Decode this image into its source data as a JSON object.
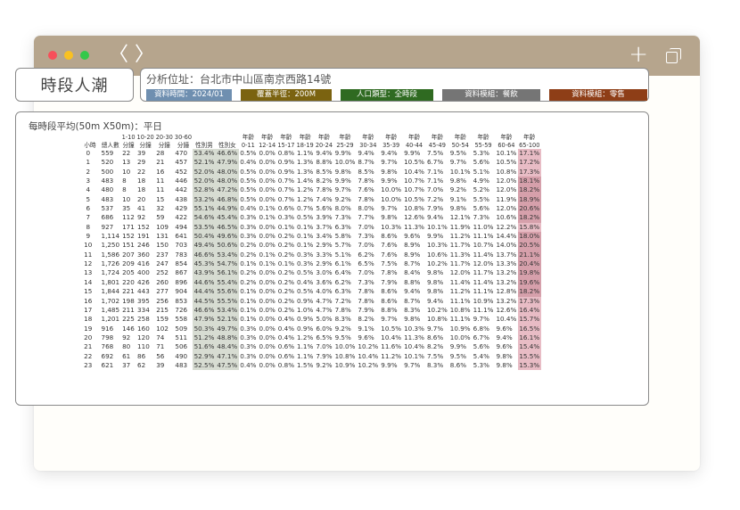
{
  "browser": {
    "back_label": "〈",
    "forward_label": "〉",
    "new_tab_label": "+",
    "colors": {
      "titlebar": "#b6a58d",
      "close": "#f74f5a",
      "minimize": "#f9c122",
      "maximize": "#34c84a"
    }
  },
  "header": {
    "title": "時段人潮",
    "location": "分析位址：台北市中山區南京西路14號",
    "tags": [
      {
        "label": "資料時間：2024/01",
        "color": "#6f8fb0",
        "width": 96
      },
      {
        "label": "覆蓋半徑：200M",
        "color": "#7b6310",
        "width": 102
      },
      {
        "label": "人口類型：全時段",
        "color": "#2f6a21",
        "width": 104
      },
      {
        "label": "資料模組：餐飲",
        "color": "#757575",
        "width": 110
      },
      {
        "label": "資料模組：零售",
        "color": "#8e3e17",
        "width": 110
      }
    ]
  },
  "table": {
    "title": "每時段平均(50m X50m)：平日",
    "headers": [
      {
        "l1": "",
        "l2": "小時"
      },
      {
        "l1": "",
        "l2": "總人數"
      },
      {
        "l1": "1-10",
        "l2": "分鐘"
      },
      {
        "l1": "10-20",
        "l2": "分鐘"
      },
      {
        "l1": "20-30",
        "l2": "分鐘"
      },
      {
        "l1": "30-60",
        "l2": "分鐘"
      },
      {
        "l1": "",
        "l2": "性別男"
      },
      {
        "l1": "",
        "l2": "性別女"
      },
      {
        "l1": "年齡",
        "l2": "0-11"
      },
      {
        "l1": "年齡",
        "l2": "12-14"
      },
      {
        "l1": "年齡",
        "l2": "15-17"
      },
      {
        "l1": "年齡",
        "l2": "18-19"
      },
      {
        "l1": "年齡",
        "l2": "20-24"
      },
      {
        "l1": "年齡",
        "l2": "25-29"
      },
      {
        "l1": "年齡",
        "l2": "30-34"
      },
      {
        "l1": "年齡",
        "l2": "35-39"
      },
      {
        "l1": "年齡",
        "l2": "40-44"
      },
      {
        "l1": "年齡",
        "l2": "45-49"
      },
      {
        "l1": "年齡",
        "l2": "50-54"
      },
      {
        "l1": "年齡",
        "l2": "55-59"
      },
      {
        "l1": "年齡",
        "l2": "60-64"
      },
      {
        "l1": "年齡",
        "l2": "65-100"
      }
    ],
    "rows": [
      [
        "0",
        "559",
        "22",
        "39",
        "28",
        "470",
        "53.4%",
        "46.6%",
        "0.5%",
        "0.0%",
        "0.8%",
        "1.1%",
        "9.4%",
        "9.9%",
        "9.4%",
        "9.4%",
        "9.9%",
        "7.5%",
        "9.5%",
        "5.3%",
        "10.1%",
        "17.1%"
      ],
      [
        "1",
        "520",
        "13",
        "29",
        "21",
        "457",
        "52.1%",
        "47.9%",
        "0.4%",
        "0.0%",
        "0.9%",
        "1.3%",
        "8.8%",
        "10.0%",
        "8.7%",
        "9.7%",
        "10.5%",
        "6.7%",
        "9.7%",
        "5.6%",
        "10.5%",
        "17.2%"
      ],
      [
        "2",
        "500",
        "10",
        "22",
        "16",
        "452",
        "52.0%",
        "48.0%",
        "0.5%",
        "0.0%",
        "0.9%",
        "1.3%",
        "8.5%",
        "9.8%",
        "8.5%",
        "9.8%",
        "10.4%",
        "7.1%",
        "10.1%",
        "5.1%",
        "10.8%",
        "17.3%"
      ],
      [
        "3",
        "483",
        "8",
        "18",
        "11",
        "446",
        "52.0%",
        "48.0%",
        "0.5%",
        "0.0%",
        "0.7%",
        "1.4%",
        "8.2%",
        "9.9%",
        "7.8%",
        "9.9%",
        "10.7%",
        "7.1%",
        "9.8%",
        "4.9%",
        "12.0%",
        "18.1%"
      ],
      [
        "4",
        "480",
        "8",
        "18",
        "11",
        "442",
        "52.8%",
        "47.2%",
        "0.5%",
        "0.0%",
        "0.7%",
        "1.2%",
        "7.8%",
        "9.7%",
        "7.6%",
        "10.0%",
        "10.7%",
        "7.0%",
        "9.2%",
        "5.2%",
        "12.0%",
        "18.2%"
      ],
      [
        "5",
        "483",
        "10",
        "20",
        "15",
        "438",
        "53.2%",
        "46.8%",
        "0.5%",
        "0.0%",
        "0.7%",
        "1.2%",
        "7.4%",
        "9.2%",
        "7.8%",
        "10.0%",
        "10.5%",
        "7.2%",
        "9.1%",
        "5.5%",
        "11.9%",
        "18.9%"
      ],
      [
        "6",
        "537",
        "35",
        "41",
        "32",
        "429",
        "55.1%",
        "44.9%",
        "0.4%",
        "0.1%",
        "0.6%",
        "0.7%",
        "5.6%",
        "8.0%",
        "8.0%",
        "9.7%",
        "10.8%",
        "7.9%",
        "9.8%",
        "5.6%",
        "12.0%",
        "20.6%"
      ],
      [
        "7",
        "686",
        "112",
        "92",
        "59",
        "422",
        "54.6%",
        "45.4%",
        "0.3%",
        "0.1%",
        "0.3%",
        "0.5%",
        "3.9%",
        "7.3%",
        "7.7%",
        "9.8%",
        "12.6%",
        "9.4%",
        "12.1%",
        "7.3%",
        "10.6%",
        "18.2%"
      ],
      [
        "8",
        "927",
        "171",
        "152",
        "109",
        "494",
        "53.5%",
        "46.5%",
        "0.3%",
        "0.0%",
        "0.1%",
        "0.1%",
        "3.7%",
        "6.3%",
        "7.0%",
        "10.3%",
        "11.3%",
        "10.1%",
        "11.9%",
        "11.0%",
        "12.2%",
        "15.8%"
      ],
      [
        "9",
        "1,114",
        "152",
        "191",
        "131",
        "641",
        "50.4%",
        "49.6%",
        "0.3%",
        "0.0%",
        "0.2%",
        "0.1%",
        "3.4%",
        "5.8%",
        "7.3%",
        "8.6%",
        "9.6%",
        "9.9%",
        "11.2%",
        "11.1%",
        "14.4%",
        "18.0%"
      ],
      [
        "10",
        "1,250",
        "151",
        "246",
        "150",
        "703",
        "49.4%",
        "50.6%",
        "0.2%",
        "0.0%",
        "0.2%",
        "0.1%",
        "2.9%",
        "5.7%",
        "7.0%",
        "7.6%",
        "8.9%",
        "10.3%",
        "11.7%",
        "10.7%",
        "14.0%",
        "20.5%"
      ],
      [
        "11",
        "1,586",
        "207",
        "360",
        "237",
        "783",
        "46.6%",
        "53.4%",
        "0.2%",
        "0.1%",
        "0.2%",
        "0.3%",
        "3.3%",
        "5.1%",
        "6.2%",
        "7.6%",
        "8.9%",
        "10.6%",
        "11.3%",
        "11.4%",
        "13.7%",
        "21.1%"
      ],
      [
        "12",
        "1,726",
        "209",
        "416",
        "247",
        "854",
        "45.3%",
        "54.7%",
        "0.1%",
        "0.1%",
        "0.1%",
        "0.3%",
        "2.9%",
        "6.1%",
        "6.5%",
        "7.5%",
        "8.7%",
        "10.2%",
        "11.7%",
        "12.0%",
        "13.3%",
        "20.4%"
      ],
      [
        "13",
        "1,724",
        "205",
        "400",
        "252",
        "867",
        "43.9%",
        "56.1%",
        "0.2%",
        "0.0%",
        "0.2%",
        "0.5%",
        "3.0%",
        "6.4%",
        "7.0%",
        "7.8%",
        "8.4%",
        "9.8%",
        "12.0%",
        "11.7%",
        "13.2%",
        "19.8%"
      ],
      [
        "14",
        "1,801",
        "220",
        "426",
        "260",
        "896",
        "44.6%",
        "55.4%",
        "0.2%",
        "0.0%",
        "0.2%",
        "0.4%",
        "3.6%",
        "6.2%",
        "7.3%",
        "7.9%",
        "8.8%",
        "9.8%",
        "11.4%",
        "11.4%",
        "13.2%",
        "19.6%"
      ],
      [
        "15",
        "1,844",
        "221",
        "443",
        "277",
        "904",
        "44.4%",
        "55.6%",
        "0.1%",
        "0.0%",
        "0.2%",
        "0.5%",
        "4.0%",
        "6.3%",
        "7.8%",
        "8.6%",
        "9.4%",
        "9.8%",
        "11.2%",
        "11.1%",
        "12.8%",
        "18.2%"
      ],
      [
        "16",
        "1,702",
        "198",
        "395",
        "256",
        "853",
        "44.5%",
        "55.5%",
        "0.1%",
        "0.0%",
        "0.2%",
        "0.9%",
        "4.7%",
        "7.2%",
        "7.8%",
        "8.6%",
        "8.7%",
        "9.4%",
        "11.1%",
        "10.9%",
        "13.2%",
        "17.3%"
      ],
      [
        "17",
        "1,485",
        "211",
        "334",
        "215",
        "726",
        "46.6%",
        "53.4%",
        "0.1%",
        "0.0%",
        "0.2%",
        "1.0%",
        "4.7%",
        "7.8%",
        "7.9%",
        "8.8%",
        "8.3%",
        "10.2%",
        "10.8%",
        "11.1%",
        "12.6%",
        "16.4%"
      ],
      [
        "18",
        "1,201",
        "225",
        "258",
        "159",
        "558",
        "47.9%",
        "52.1%",
        "0.1%",
        "0.0%",
        "0.4%",
        "0.9%",
        "5.0%",
        "8.3%",
        "8.2%",
        "9.7%",
        "9.8%",
        "10.8%",
        "11.1%",
        "9.7%",
        "10.4%",
        "15.7%"
      ],
      [
        "19",
        "916",
        "146",
        "160",
        "102",
        "509",
        "50.3%",
        "49.7%",
        "0.3%",
        "0.0%",
        "0.4%",
        "0.9%",
        "6.0%",
        "9.2%",
        "9.1%",
        "10.5%",
        "10.3%",
        "9.7%",
        "10.9%",
        "6.8%",
        "9.6%",
        "16.5%"
      ],
      [
        "20",
        "798",
        "92",
        "120",
        "74",
        "511",
        "51.2%",
        "48.8%",
        "0.3%",
        "0.0%",
        "0.4%",
        "1.2%",
        "6.5%",
        "9.5%",
        "9.6%",
        "10.4%",
        "11.3%",
        "8.6%",
        "10.0%",
        "6.7%",
        "9.4%",
        "16.1%"
      ],
      [
        "21",
        "768",
        "80",
        "110",
        "71",
        "506",
        "51.6%",
        "48.4%",
        "0.3%",
        "0.0%",
        "0.6%",
        "1.1%",
        "7.0%",
        "10.0%",
        "10.2%",
        "11.6%",
        "10.4%",
        "8.2%",
        "9.9%",
        "5.6%",
        "9.6%",
        "15.4%"
      ],
      [
        "22",
        "692",
        "61",
        "86",
        "56",
        "490",
        "52.9%",
        "47.1%",
        "0.3%",
        "0.0%",
        "0.6%",
        "1.1%",
        "7.9%",
        "10.8%",
        "10.4%",
        "11.2%",
        "10.1%",
        "7.5%",
        "9.5%",
        "5.4%",
        "9.8%",
        "15.5%"
      ],
      [
        "23",
        "621",
        "37",
        "62",
        "39",
        "483",
        "52.5%",
        "47.5%",
        "0.4%",
        "0.0%",
        "0.8%",
        "1.5%",
        "9.2%",
        "10.9%",
        "10.2%",
        "9.9%",
        "9.7%",
        "8.3%",
        "8.6%",
        "5.3%",
        "9.8%",
        "15.3%"
      ]
    ],
    "colors": {
      "gender": "#d7dcd2",
      "senior": "#d6a0ab"
    }
  }
}
